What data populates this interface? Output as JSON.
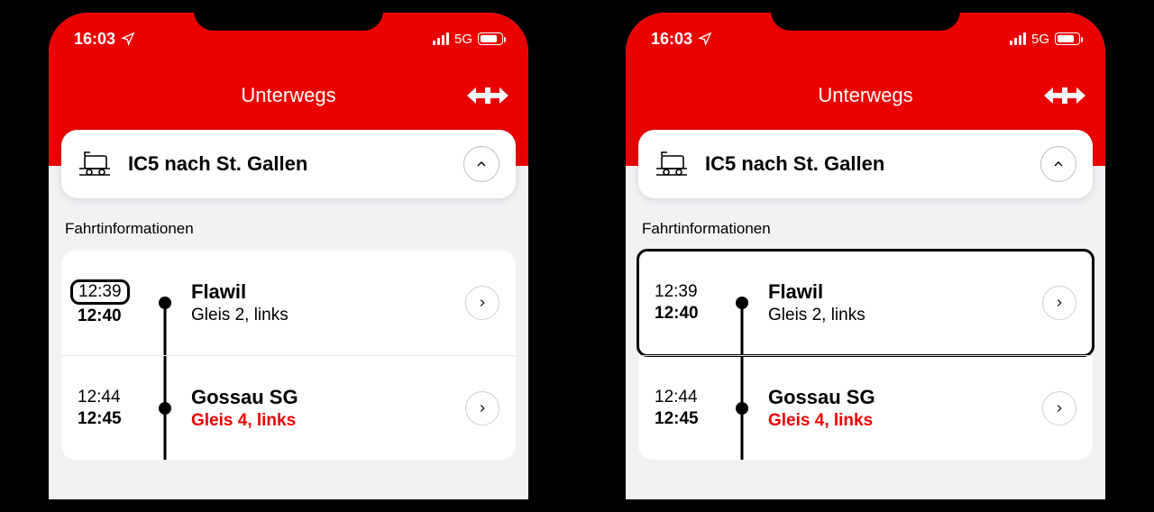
{
  "status": {
    "time": "16:03",
    "network": "5G"
  },
  "header": {
    "title": "Unterwegs"
  },
  "route": {
    "title": "IC5 nach St. Gallen"
  },
  "section_label": "Fahrtinformationen",
  "stops": [
    {
      "arr": "12:39",
      "dep": "12:40",
      "name": "Flawil",
      "track": "Gleis 2, links",
      "track_warn": false
    },
    {
      "arr": "12:44",
      "dep": "12:45",
      "name": "Gossau SG",
      "track": "Gleis 4, links",
      "track_warn": true
    }
  ]
}
